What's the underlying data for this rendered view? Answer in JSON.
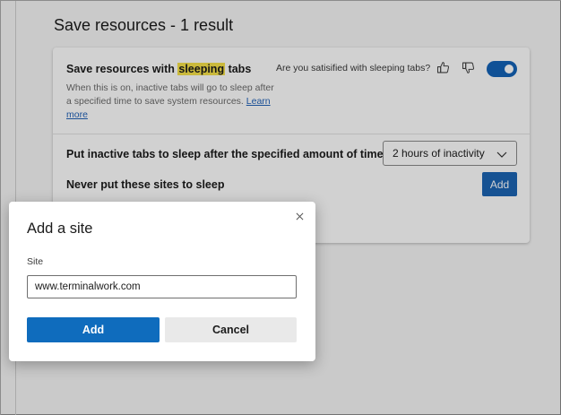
{
  "section": {
    "title": "Save resources - 1 result"
  },
  "feature": {
    "title_before": "Save resources with ",
    "title_highlight": "sleeping",
    "title_after": " tabs",
    "description": "When this is on, inactive tabs will go to sleep after a specified time to save system resources.",
    "learn_more": "Learn more",
    "feedback_question": "Are you satisified with sleeping tabs?",
    "toggle_on": true
  },
  "sleep_setting": {
    "label": "Put inactive tabs to sleep after the specified amount of time:",
    "selected": "2 hours of inactivity"
  },
  "never_sleep": {
    "label": "Never put these sites to sleep",
    "add_label": "Add"
  },
  "dialog": {
    "title": "Add a site",
    "site_label": "Site",
    "site_value": "www.terminalwork.com",
    "add_label": "Add",
    "cancel_label": "Cancel"
  },
  "colors": {
    "accent": "#0f6cbd",
    "highlight": "#f7e24a",
    "link": "#2262b8"
  }
}
